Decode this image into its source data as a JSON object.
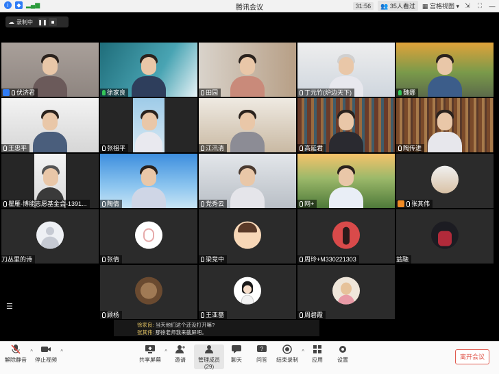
{
  "titlebar": {
    "title": "腾讯会议",
    "timer": "31:56",
    "viewers": "35人看过",
    "view_mode": "宫格视图"
  },
  "recording": {
    "label": "录制中"
  },
  "participants": [
    {
      "name": "伏济君",
      "host": true
    },
    {
      "name": "徐家良",
      "mic_on": true
    },
    {
      "name": "田园"
    },
    {
      "name": "丁元竹(炉边天下)"
    },
    {
      "name": "魏娜",
      "mic_on": true
    },
    {
      "name": "王忠平"
    },
    {
      "name": "张祖平"
    },
    {
      "name": "江汛清"
    },
    {
      "name": "高延君"
    },
    {
      "name": "陶传进"
    },
    {
      "name": "瞿雁-博能志愿基金会-1391..."
    },
    {
      "name": "陶倩"
    },
    {
      "name": "党秀云"
    },
    {
      "name": "网+"
    },
    {
      "name": "张其伟",
      "host": true
    },
    {
      "name": "刀丛里的诗"
    },
    {
      "name": "张倩"
    },
    {
      "name": "梁竞中"
    },
    {
      "name": "周玲+M330221303"
    },
    {
      "name": "益融"
    },
    {
      "name": "顾杨"
    },
    {
      "name": "王亚蔷"
    },
    {
      "name": "周碧霞"
    }
  ],
  "chat": [
    {
      "from": "徐家良:",
      "text": "当天他们这个还没打开嘛?"
    },
    {
      "from": "张其伟:",
      "text": "那徐老师我来截屏吧。"
    }
  ],
  "toolbar": {
    "mute": "解除静音",
    "stop_video": "停止视频",
    "share": "共享屏幕",
    "invite": "邀请",
    "members": "管理成员(29)",
    "chat": "聊天",
    "qa": "问答",
    "end_record": "结束录制",
    "apps": "应用",
    "settings": "设置",
    "leave": "离开会议"
  }
}
